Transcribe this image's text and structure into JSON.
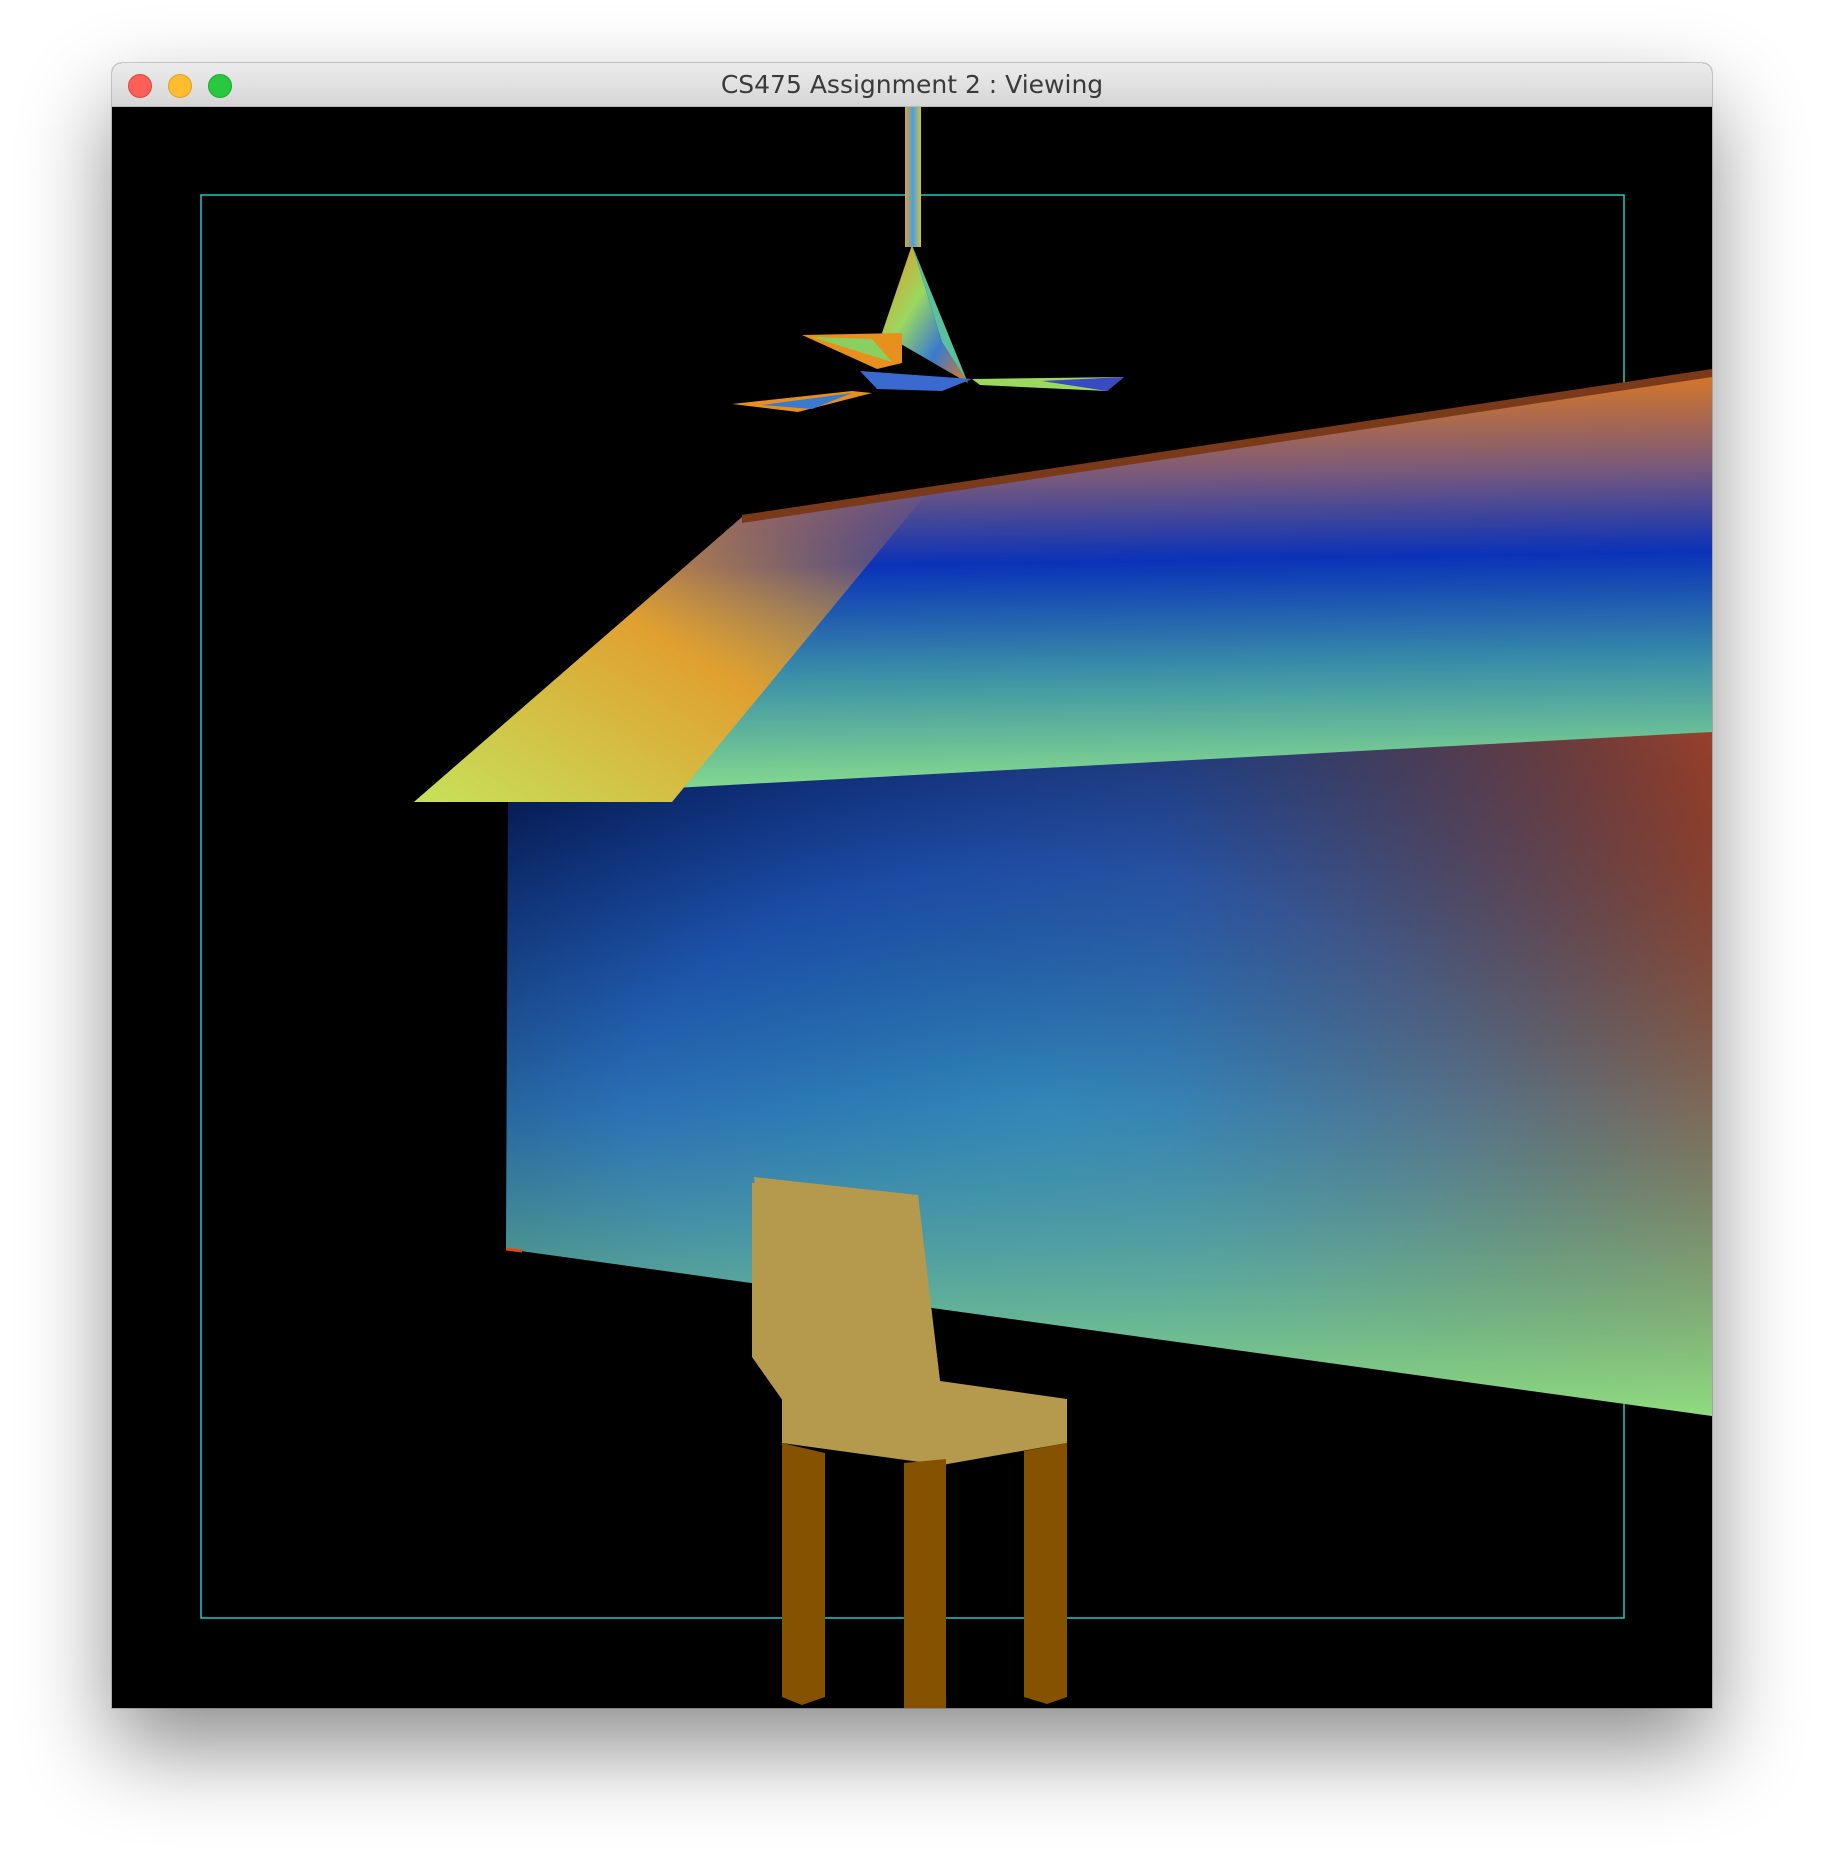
{
  "window": {
    "title": "CS475 Assignment 2 : Viewing"
  },
  "traffic_lights": {
    "close_color": "#ff5f57",
    "minimize_color": "#febc2e",
    "zoom_color": "#28c840"
  },
  "scene": {
    "background_color": "#000000",
    "viewport_frame_color": "#22c7c0",
    "objects": [
      "ceiling-fan",
      "roof-ceiling-plane",
      "wall-plane",
      "chair"
    ],
    "chair_seat_color": "#b5994d",
    "chair_leg_color": "#855200"
  }
}
